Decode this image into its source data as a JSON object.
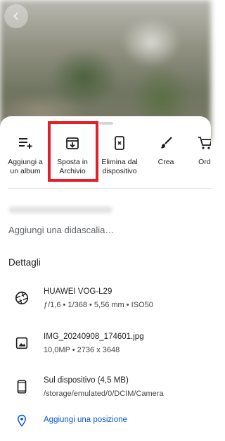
{
  "actions": [
    {
      "label": "Aggiungi a un album",
      "icon": "add-to-playlist-icon"
    },
    {
      "label": "Sposta in Archivio",
      "icon": "archive-icon"
    },
    {
      "label": "Elimina dal dispositivo",
      "icon": "delete-from-device-icon"
    },
    {
      "label": "Crea",
      "icon": "brush-icon"
    },
    {
      "label": "Ordi",
      "icon": "cart-icon"
    }
  ],
  "caption_placeholder": "Aggiungi una didascalia…",
  "details": {
    "title": "Dettagli",
    "camera": {
      "name": "HUAWEI VOG-L29",
      "specs": "ƒ/1,6  •  1/368  •  5,56 mm  •  ISO50"
    },
    "file": {
      "name": "IMG_20240908_174601.jpg",
      "specs": "10,0MP  •  2736 x 3648"
    },
    "storage": {
      "name": "Sul dispositivo (4,5 MB)",
      "path": "/storage/emulated/0/DCIM/Camera"
    },
    "location_action": "Aggiungi una posizione"
  },
  "colors": {
    "link": "#0b57d0",
    "highlight": "#e3202a"
  }
}
